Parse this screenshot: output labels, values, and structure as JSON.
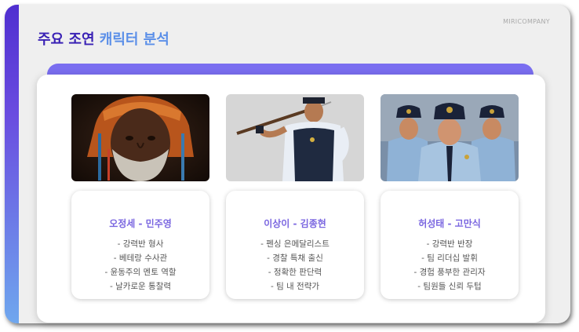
{
  "slide": {
    "brand": "MIRICOMPANY",
    "title_part1": "주요 조연",
    "title_part2": "캐릭터 분석",
    "colors": {
      "accent": "#4f2fd0",
      "title_dark": "#3a22b5",
      "title_light": "#5b8fe8",
      "panel_strip": "#7a6ef0",
      "name": "#7a66e0"
    }
  },
  "characters": [
    {
      "name": "오정세 - 민주영",
      "image": "elderly-bearded-man-portrait",
      "traits": [
        "- 강력반 형사",
        "- 베테랑 수사관",
        "- 윤동주의 멘토 역할",
        "- 날카로운 통찰력"
      ]
    },
    {
      "name": "이상이 - 김종현",
      "image": "officer-with-fencing-sword",
      "traits": [
        "- 펜싱 은메달리스트",
        "- 경찰 특채 출신",
        "- 정확한 판단력",
        "- 팀 내 전략가"
      ]
    },
    {
      "name": "허성태 - 고만식",
      "image": "three-police-officers",
      "traits": [
        "- 강력반 반장",
        "- 팀 리더십 발휘",
        "- 경험 풍부한 관리자",
        "- 팀원들 신뢰 두텁"
      ]
    }
  ]
}
